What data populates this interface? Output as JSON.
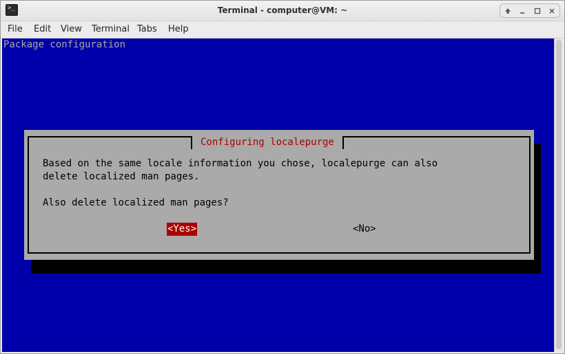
{
  "window": {
    "title": "Terminal - computer@VM: ~",
    "app_icon_glyph": ">_",
    "controls": [
      "up-arrow-icon",
      "minimize-icon",
      "maximize-icon",
      "close-icon"
    ]
  },
  "menu": {
    "items": [
      "File",
      "Edit",
      "View",
      "Terminal",
      "Tabs",
      "Help"
    ]
  },
  "terminal": {
    "backtitle": "Package configuration",
    "background": "#0000aa"
  },
  "dialog": {
    "title": "Configuring localepurge",
    "body_line1": "Based on the same locale information you chose, localepurge can also",
    "body_line2": "delete localized man pages.",
    "question": "Also delete localized man pages?",
    "yes_label": "<Yes>",
    "no_label": "<No>",
    "accent": "#aa0000",
    "background": "#aaaaaa"
  }
}
